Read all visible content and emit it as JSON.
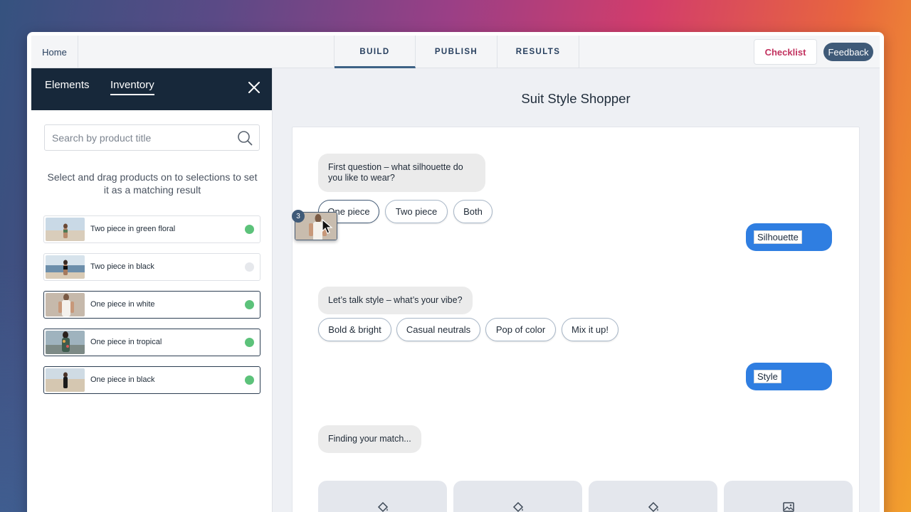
{
  "topbar": {
    "home": "Home",
    "tabs": [
      "BUILD",
      "PUBLISH",
      "RESULTS"
    ],
    "checklist": "Checklist",
    "feedback": "Feedback"
  },
  "left_panel": {
    "tabs": [
      "Elements",
      "Inventory"
    ],
    "search_placeholder": "Search by product title",
    "instructions": "Select and drag products on to selections to set it as a matching result",
    "products": [
      {
        "name": "Two piece in green floral",
        "status": "matched"
      },
      {
        "name": "Two piece in black",
        "status": "unmatched"
      },
      {
        "name": "One piece in white",
        "status": "matched"
      },
      {
        "name": "One piece in tropical",
        "status": "matched"
      },
      {
        "name": "One piece in black",
        "status": "matched"
      }
    ]
  },
  "main": {
    "title": "Suit Style Shopper",
    "q1": {
      "text": "First question – what silhouette do you like to wear?",
      "options": [
        "One piece",
        "Two piece",
        "Both"
      ],
      "tag": "Silhouette"
    },
    "q2": {
      "text": "Let’s talk style – what’s your vibe?",
      "options": [
        "Bold & bright",
        "Casual neutrals",
        "Pop of color",
        "Mix it up!"
      ],
      "tag": "Style"
    },
    "finding": "Finding your match...",
    "drag_count": "3"
  },
  "colors": {
    "accent_blue": "#2f7ee1",
    "dark_navy": "#17283a",
    "checklist_red": "#c2325f",
    "status_green": "#5cc27a"
  }
}
